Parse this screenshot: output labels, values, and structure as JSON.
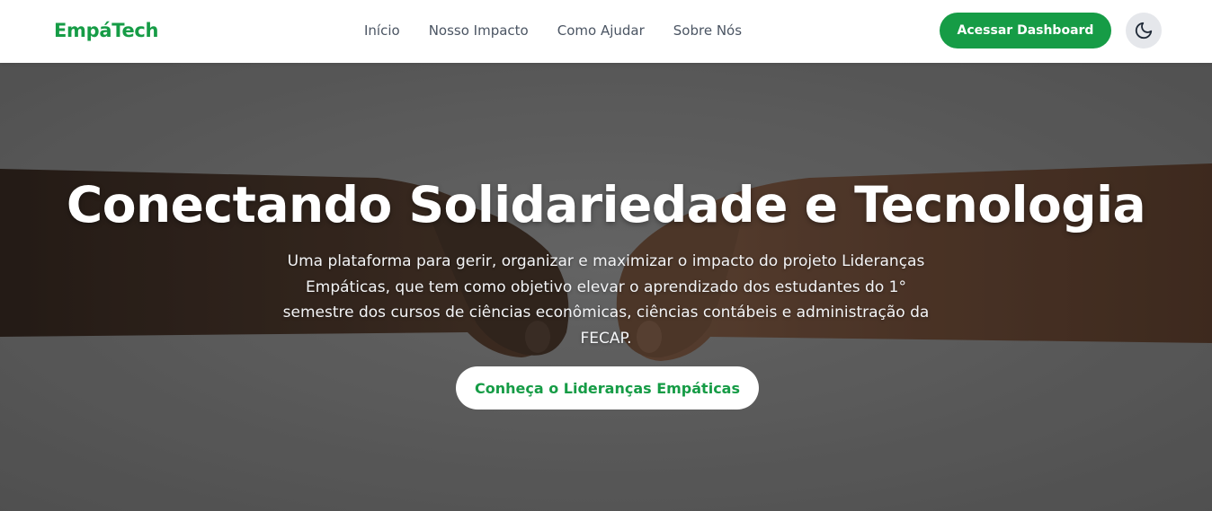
{
  "brand": {
    "name": "EmpáTech",
    "color": "#169c46"
  },
  "nav": {
    "links": [
      {
        "label": "Início"
      },
      {
        "label": "Nosso Impacto"
      },
      {
        "label": "Como Ajudar"
      },
      {
        "label": "Sobre Nós"
      }
    ],
    "dashboard_button": "Acessar Dashboard",
    "theme_toggle_icon": "moon-icon"
  },
  "hero": {
    "title": "Conectando Solidariedade e Tecnologia",
    "description": "Uma plataforma para gerir, organizar e maximizar o impacto do projeto Lideranças Empáticas, que tem como objetivo elevar o aprendizado dos estudantes do 1° semestre dos cursos de ciências econômicas, ciências contábeis e administração da FECAP.",
    "cta_label": "Conheça o Lideranças Empáticas",
    "background_image": "two fists bumping over a grey textured wall"
  }
}
